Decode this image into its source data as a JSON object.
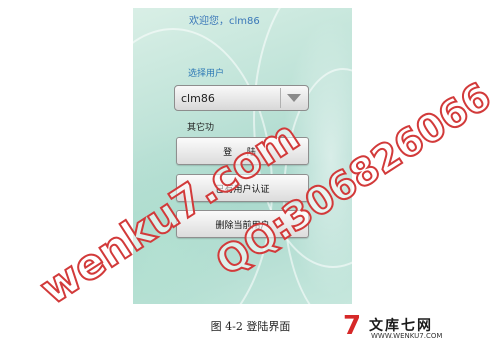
{
  "screen": {
    "welcome_text": "欢迎您，clm86",
    "select_user_label": "选择用户",
    "selected_user": "clm86",
    "other_label": "其它功",
    "buttons": {
      "login": "登 陆",
      "existing_user_auth": "已有用户认证",
      "delete_current_user": "删除当前用户"
    }
  },
  "caption": "图 4-2 登陆界面",
  "watermarks": {
    "site": "wenku7.com",
    "qq": "QQ:306826066"
  },
  "logo": {
    "mark": "7",
    "text": "文库七网",
    "url": "WWW.WENKU7.COM"
  },
  "colors": {
    "watermark_stroke": "#d23a3a",
    "logo_red": "#d62828",
    "label_blue": "#2d79b5"
  }
}
